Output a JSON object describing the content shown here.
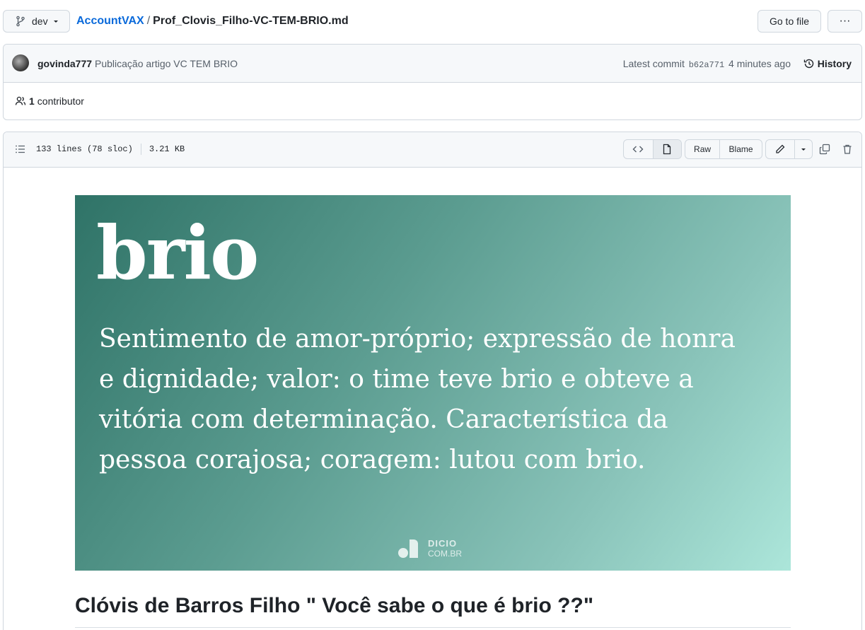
{
  "topbar": {
    "branch": "dev",
    "repo": "AccountVAX",
    "separator": "/",
    "file": "Prof_Clovis_Filho-VC-TEM-BRIO.md",
    "goto_label": "Go to file",
    "more_label": "···"
  },
  "commit": {
    "author": "govinda777",
    "message": "Publicação artigo VC TEM BRIO",
    "latest_prefix": "Latest commit",
    "sha": "b62a771",
    "time": "4 minutes ago",
    "history_label": "History",
    "contributors_count": "1",
    "contributors_label": "contributor"
  },
  "file": {
    "lines": "133 lines (78 sloc)",
    "size": "3.21 KB",
    "raw_label": "Raw",
    "blame_label": "Blame"
  },
  "hero": {
    "word": "brio",
    "definition": "Sentimento de amor-próprio; expressão de honra e dignidade; valor: o time teve brio e obteve a vitória com determinação. Característica da pessoa corajosa; coragem: lutou com brio.",
    "brand": "DICIO",
    "brand_sub": "COM.BR",
    "colors": {
      "gradient_start": "#2f7367",
      "gradient_end": "#ace6da"
    }
  },
  "article": {
    "heading": "Clóvis de Barros Filho \" Você sabe o que é brio ??\""
  },
  "icons": [
    "git-branch-icon",
    "caret-down-icon",
    "history-icon",
    "people-icon",
    "list-icon",
    "code-icon",
    "file-icon",
    "pencil-icon",
    "copy-icon",
    "trash-icon"
  ]
}
